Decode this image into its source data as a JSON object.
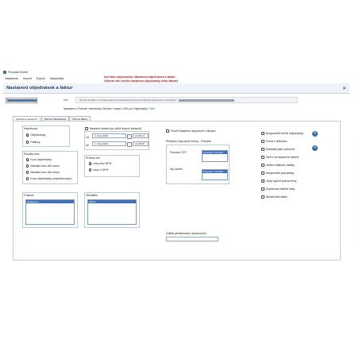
{
  "window": {
    "title": "Pohoda Křížek"
  },
  "menu": {
    "items": [
      "Nastavení",
      "Import",
      "Export",
      "Nápověda"
    ]
  },
  "promo": {
    "line1": "Nul lidee objednavky: Nastavení objednávek a faktur",
    "line2": "Vyberte zde chcete nastavení objednávky nebo faktury"
  },
  "header": {
    "title": "Nastavení objednávek a faktur"
  },
  "top": {
    "url_label": "Url:",
    "url_value": "http://pohoda277.pohodaonwebs.cz/modules/importexport/orders/pohoda/orders.php?hash=",
    "import_note_prefix": "Nastavení v Pohodě: Internetový Obchod / Import / URL pro Objednávky:",
    "import_note_link": "XNM"
  },
  "tabs": [
    "Společná nastavení",
    "Přenos Objednávek",
    "Přenos faktur"
  ],
  "importovat": {
    "title": "Importovat",
    "options": [
      "Objednávky",
      "Faktury"
    ],
    "selected": 0
  },
  "datefilter": {
    "check_label": "Nastavit období pro příští import (dotazů)",
    "od_label": "od",
    "do_label": "do",
    "od_date": "3. října 2021",
    "od_time": "14:36:17",
    "do_date": "1. října 2021",
    "do_time": "11:48:00"
  },
  "kurz": {
    "title": "Použitý kurz",
    "options": [
      "Kurz objednávky",
      "Aktuální kurz dle kurzu",
      "Aktuální kurz dle kurzu",
      "Kurz objednávky (nepřebírování)"
    ],
    "selected": 0
  },
  "prenos": {
    "title": "Převod cen",
    "options": [
      "ceny bez DPH",
      "ceny s DPH"
    ],
    "selected": 0
  },
  "ciselna": {
    "title": "Číselná",
    "selected": "Nastaveno"
  },
  "stredisko": {
    "title": "Středisko",
    "selected": "Žádná"
  },
  "doprava": {
    "check_label": "Použít lokalního dopravců z eshopu",
    "heading": "Přiřazení dopravců eshop - Pohoda",
    "rows": [
      {
        "label": "Pohoda CZ/7",
        "value": "Doprava v Pohodě"
      },
      {
        "label": "My carrier",
        "value": "Doprava v Pohodě"
      }
    ]
  },
  "udaje": {
    "label": "Údělal předkontace dopravného",
    "value": ""
  },
  "right_checks": [
    {
      "label": "Nespouštět ručně objednávky",
      "checked": true
    },
    {
      "label": "Firma s Nitkovou",
      "checked": false
    },
    {
      "label": "Dokládat jako vyřízené",
      "checked": false
    },
    {
      "label": "Slevu na dopravné zahrnit",
      "checked": false
    },
    {
      "label": "Vedení dálkové zásilky",
      "checked": false
    },
    {
      "label": "Nespouštět poznámky",
      "checked": false
    },
    {
      "label": "Vždy vyplnit jména firmy",
      "checked": true
    },
    {
      "label": "Doplňovat číselné řady",
      "checked": false
    },
    {
      "label": "Neodečítat sklad",
      "checked": false
    }
  ]
}
